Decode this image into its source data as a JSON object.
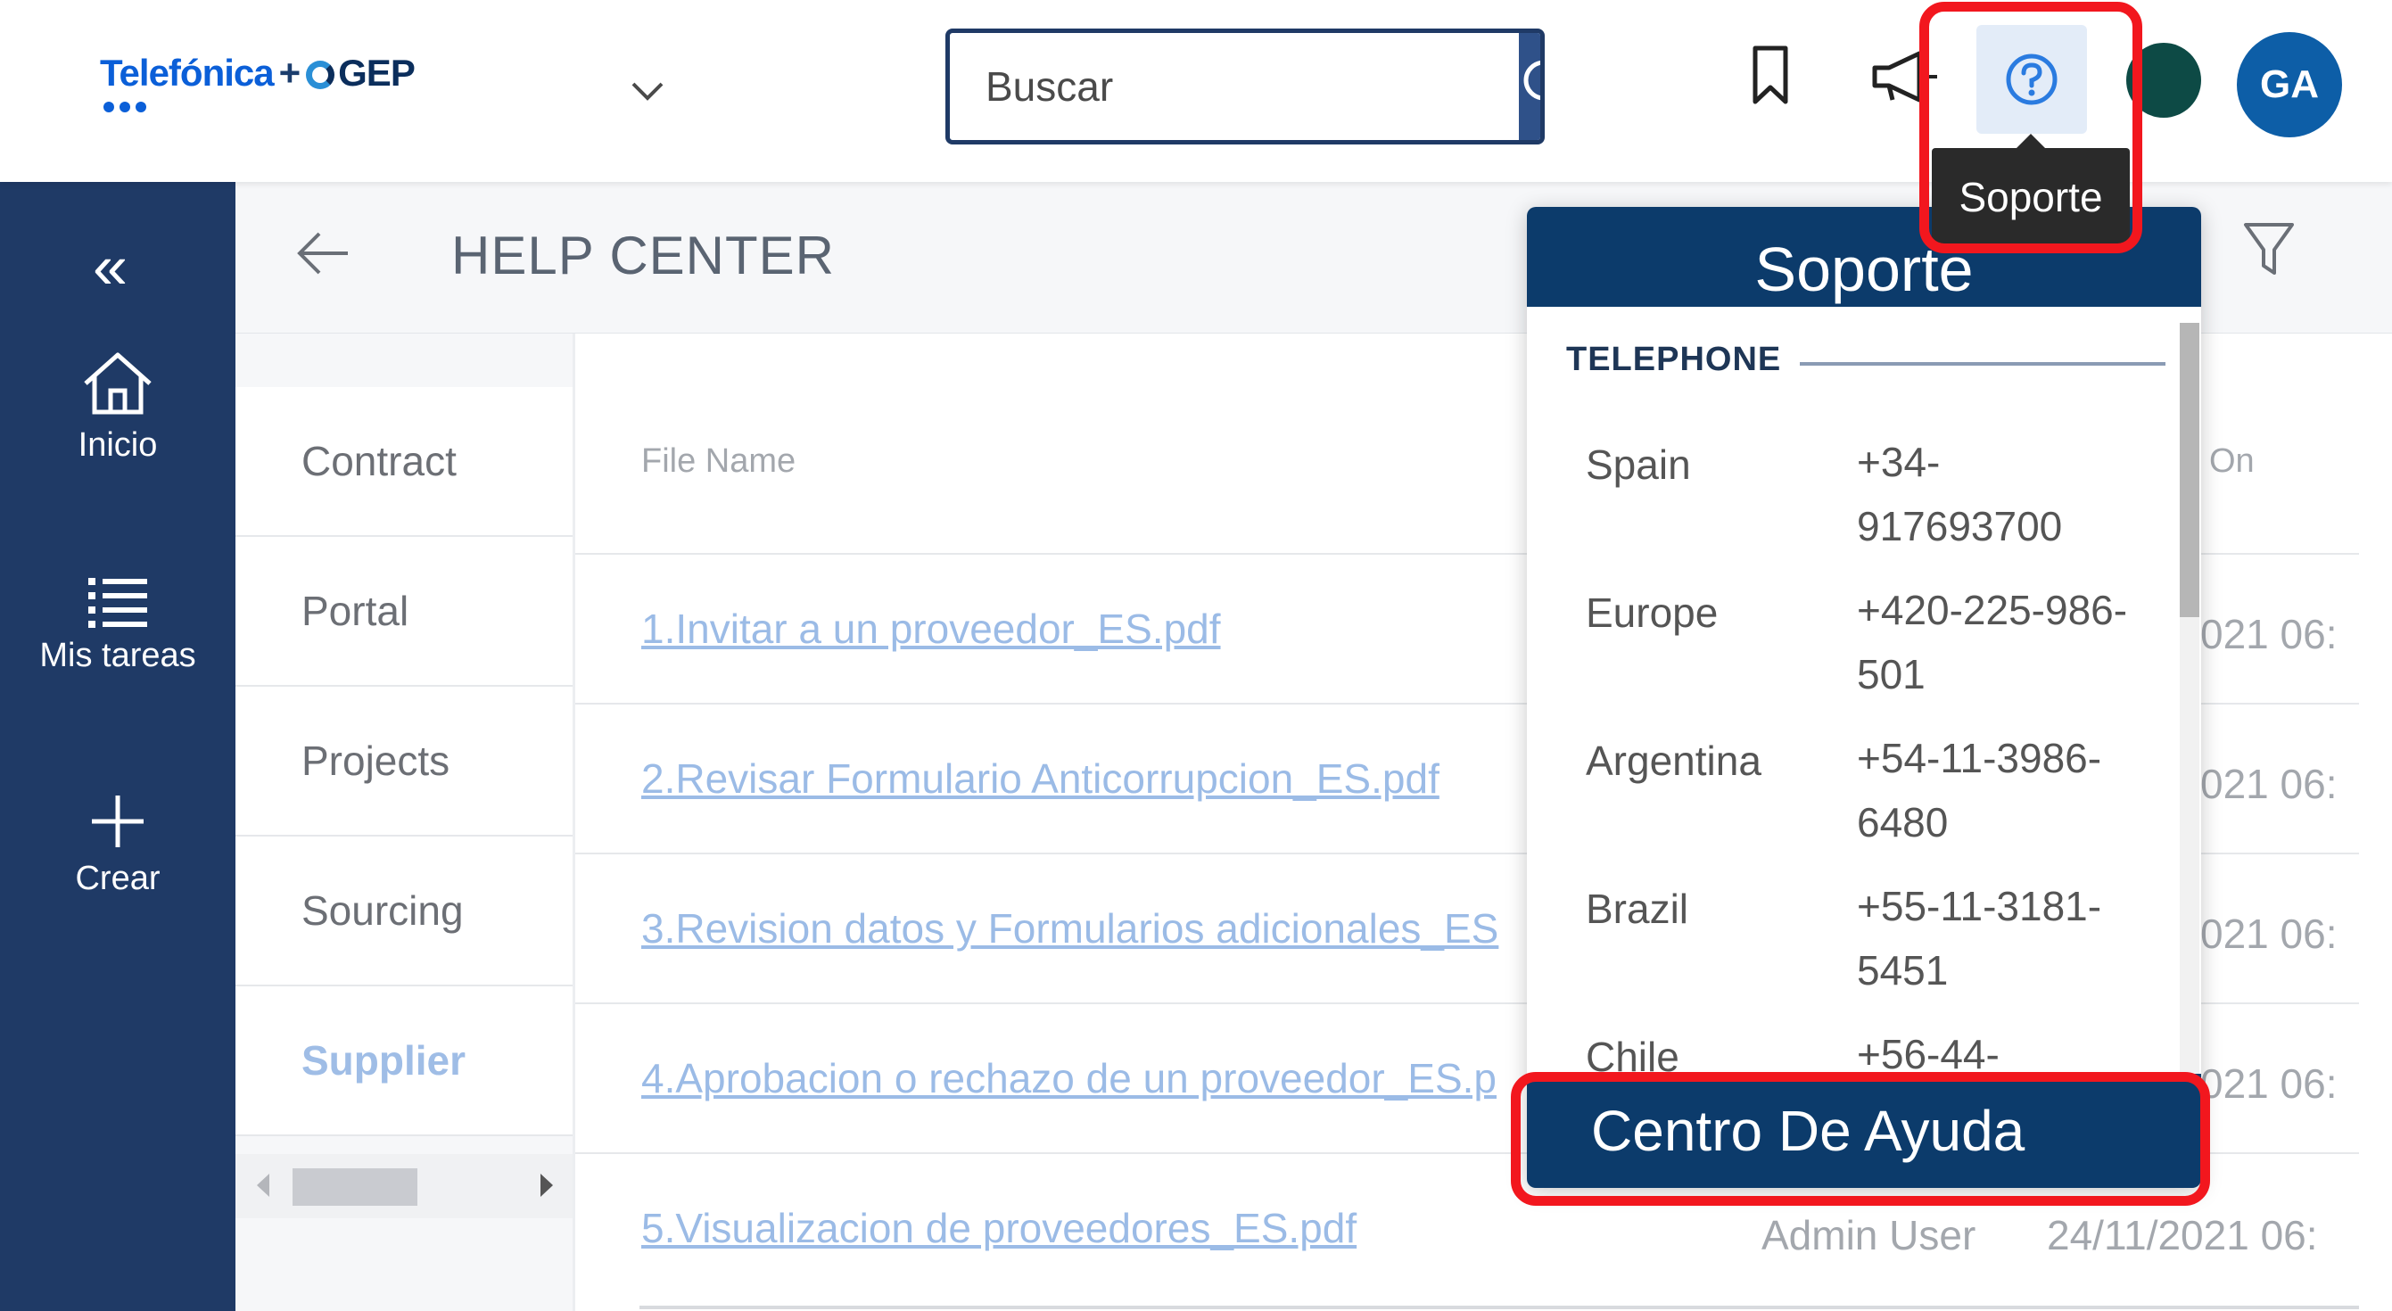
{
  "header": {
    "logo": {
      "brand1": "Telefónica",
      "plus": "+",
      "brand2": "GEP"
    },
    "search": {
      "placeholder": "Buscar"
    },
    "icons": [
      "chevron-down-icon",
      "search-icon",
      "bookmark-icon",
      "megaphone-icon",
      "help-icon",
      "partner-logo-icon"
    ],
    "avatar_initials": "GA",
    "tooltip": "Soporte"
  },
  "sidebar": {
    "items": [
      {
        "label": "Inicio",
        "icon": "home-icon"
      },
      {
        "label": "Mis tareas",
        "icon": "list-icon"
      },
      {
        "label": "Crear",
        "icon": "plus-icon"
      }
    ]
  },
  "page": {
    "title": "HELP CENTER"
  },
  "categories": [
    {
      "label": "Contract"
    },
    {
      "label": "Portal"
    },
    {
      "label": "Projects"
    },
    {
      "label": "Sourcing"
    },
    {
      "label": "Supplier",
      "active": true
    }
  ],
  "files": {
    "columns": {
      "file_name": "File Name",
      "on": "On"
    },
    "rows": [
      {
        "name": "1.Invitar a un proveedor_ES.pdf",
        "user": "",
        "date": "021 06:"
      },
      {
        "name": "2.Revisar Formulario Anticorrupcion_ES.pdf",
        "user": "",
        "date": "021 06:"
      },
      {
        "name": "3.Revision datos y Formularios adicionales_ES",
        "user": "",
        "date": "021 06:"
      },
      {
        "name": "4.Aprobacion o rechazo de un proveedor_ES.p",
        "user": "",
        "date": "021 06:"
      },
      {
        "name": "5.Visualizacion de proveedores_ES.pdf",
        "user": "Admin User",
        "date": "24/11/2021 06:"
      }
    ]
  },
  "support": {
    "title": "Soporte",
    "section": "TELEPHONE",
    "phones": [
      {
        "country": "Spain",
        "number": "+34-917693700"
      },
      {
        "country": "Europe",
        "number": "+420-225-986-501"
      },
      {
        "country": "Argentina",
        "number": "+54-11-3986-6480"
      },
      {
        "country": "Brazil",
        "number": "+55-11-3181-5451"
      },
      {
        "country": "Chile",
        "number": "+56-44-"
      }
    ],
    "help_center": "Centro De Ayuda"
  },
  "colors": {
    "nav": "#1f3a66",
    "support_header": "#0c3b6b",
    "highlight": "#f2171e",
    "link": "#9bbbe6"
  }
}
